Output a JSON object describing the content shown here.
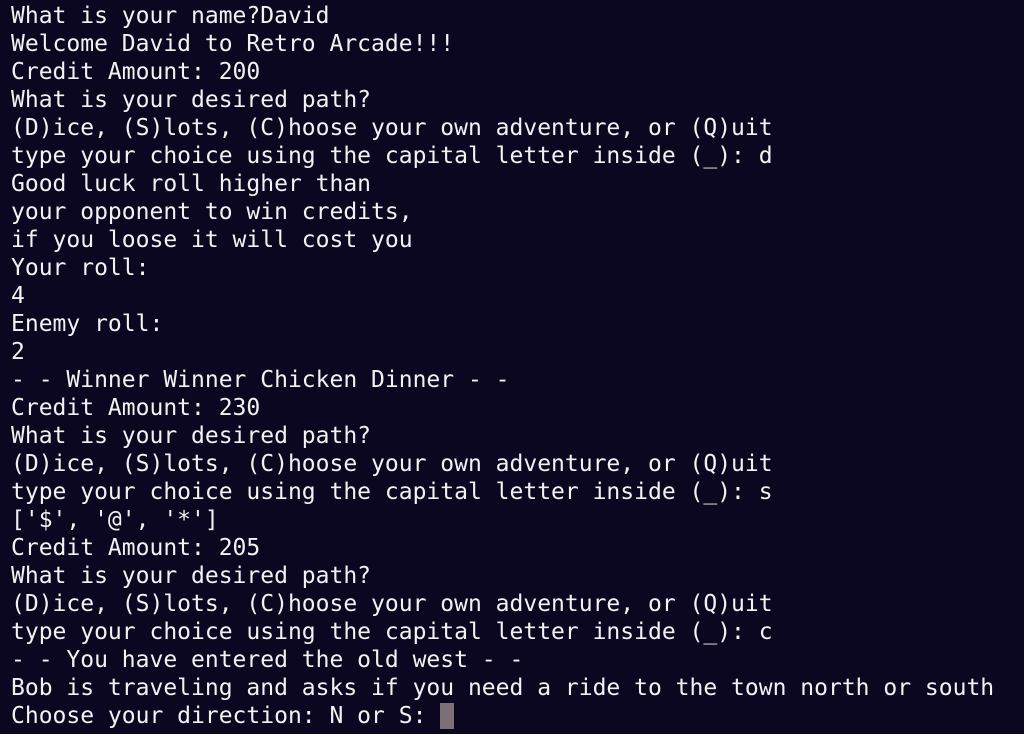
{
  "terminal": {
    "lines": [
      "What is your name?David",
      "Welcome David to Retro Arcade!!!",
      "Credit Amount: 200",
      "What is your desired path?",
      "(D)ice, (S)lots, (C)hoose your own adventure, or (Q)uit",
      "type your choice using the capital letter inside (_): d",
      "Good luck roll higher than",
      "your opponent to win credits,",
      "if you loose it will cost you",
      "Your roll:",
      "4",
      "Enemy roll:",
      "2",
      "- - Winner Winner Chicken Dinner - -",
      "Credit Amount: 230",
      "What is your desired path?",
      "(D)ice, (S)lots, (C)hoose your own adventure, or (Q)uit",
      "type your choice using the capital letter inside (_): s",
      "['$', '@', '*']",
      "Credit Amount: 205",
      "What is your desired path?",
      "(D)ice, (S)lots, (C)hoose your own adventure, or (Q)uit",
      "type your choice using the capital letter inside (_): c",
      "- - You have entered the old west - -",
      "Bob is traveling and asks if you need a ride to the town north or south"
    ],
    "prompt": "Choose your direction: N or S: ",
    "colors": {
      "background": "#0c0720",
      "foreground": "#f2f2f2",
      "cursor": "#7c7077"
    }
  }
}
